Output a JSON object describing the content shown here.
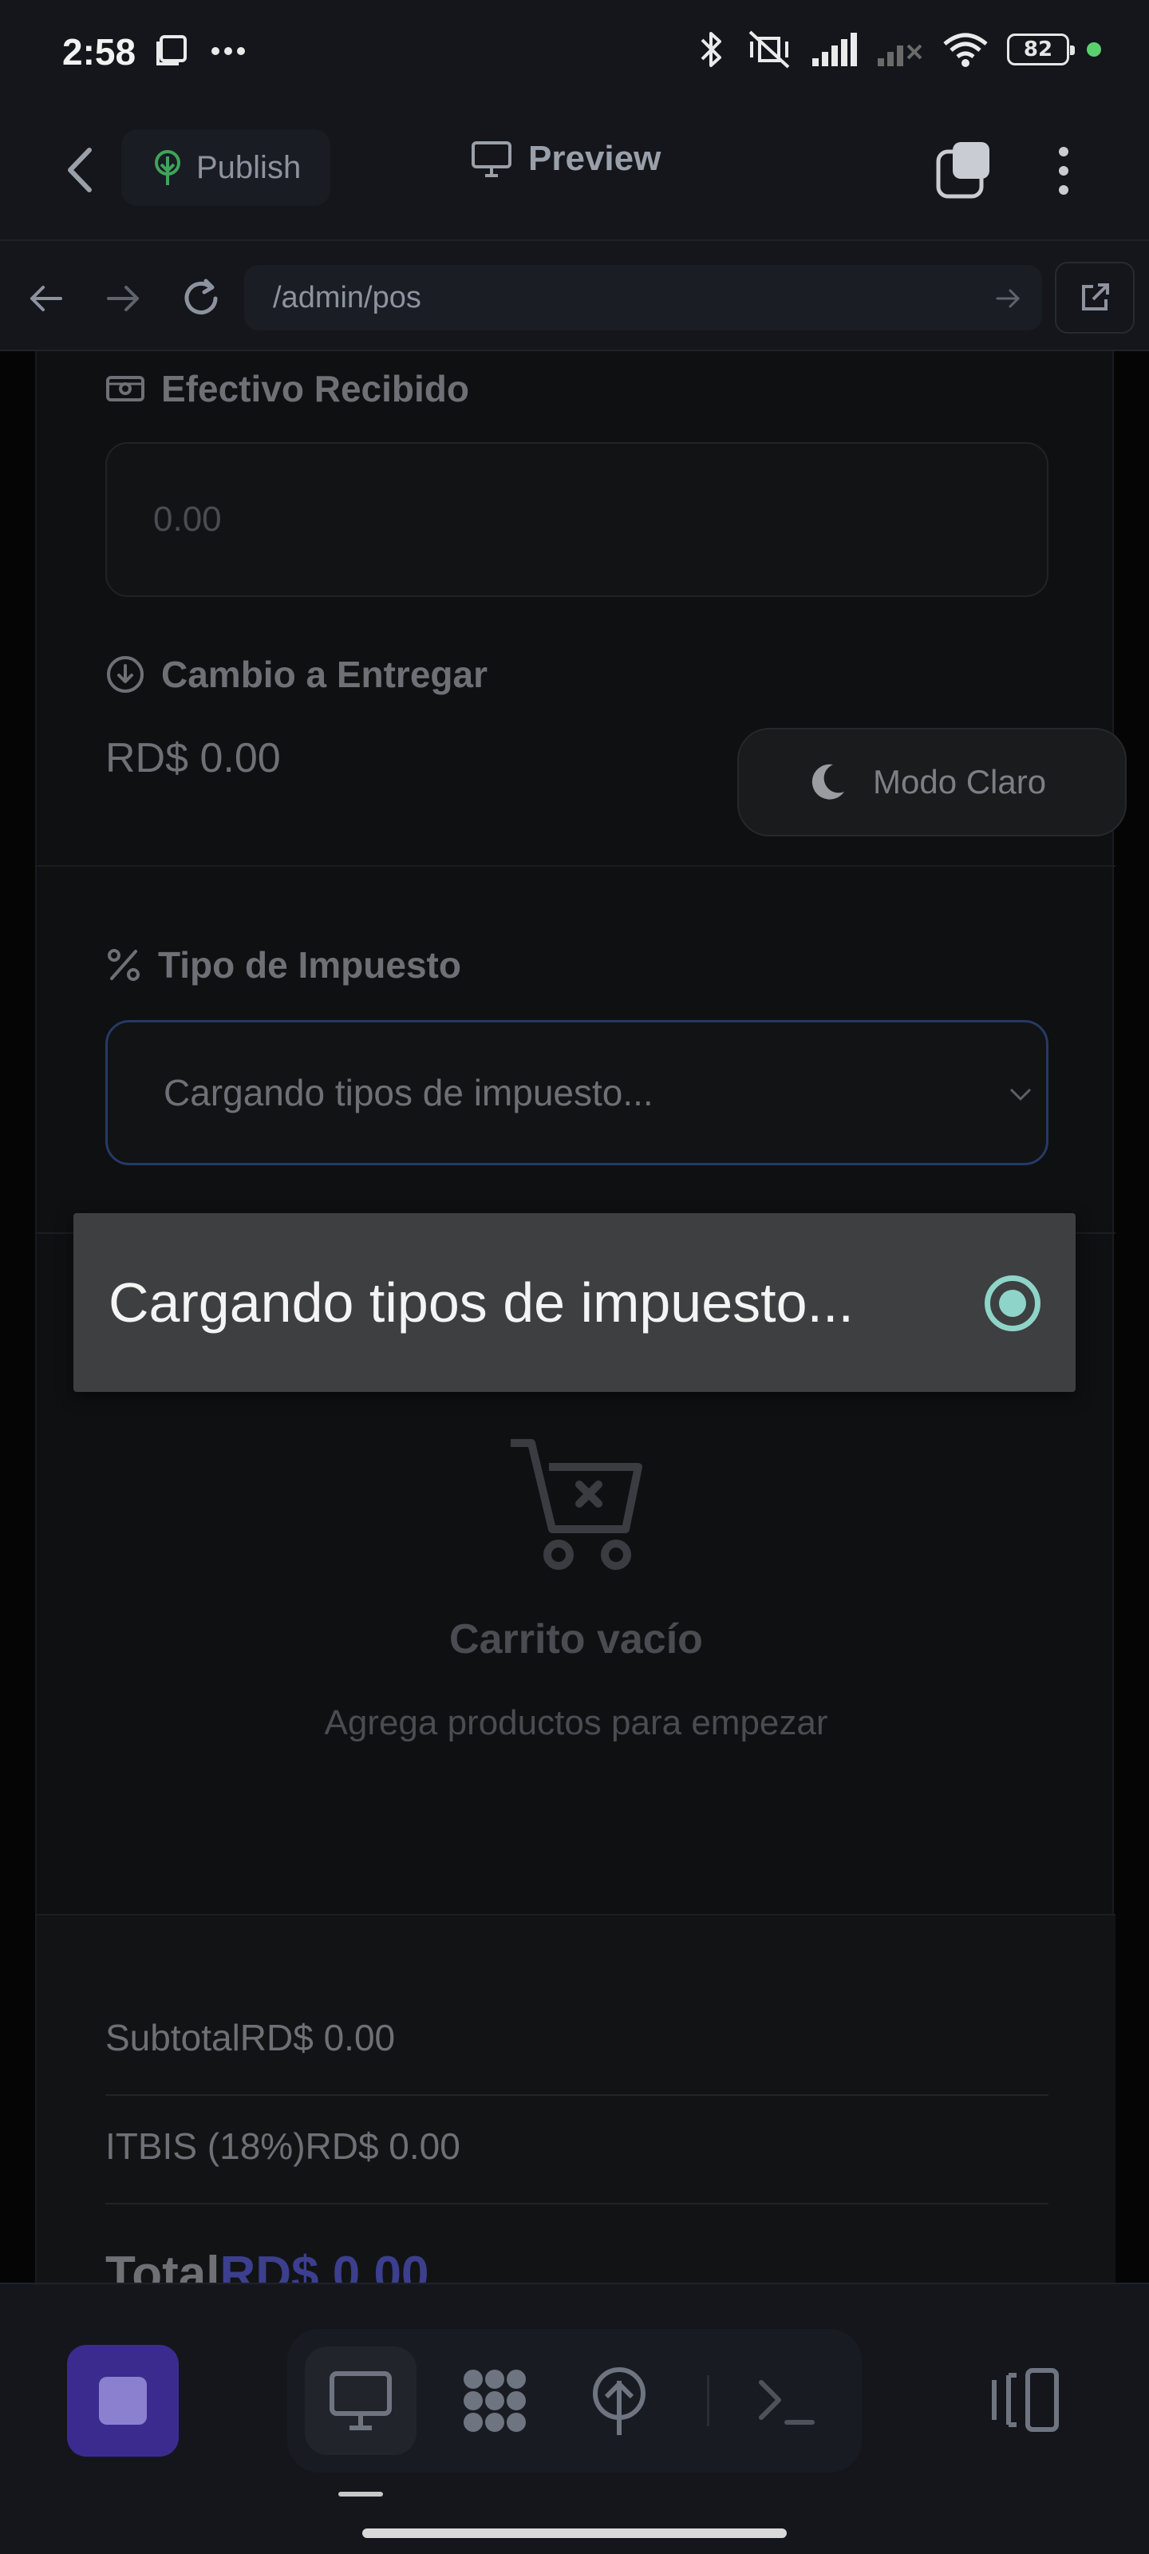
{
  "status_bar": {
    "time": "2:58",
    "left_icons": [
      "screen-icon",
      "more-dots-icon"
    ],
    "right_icons": [
      "bluetooth-icon",
      "mute-vibrate-icon",
      "signal-icon",
      "signal-off-icon",
      "wifi-icon"
    ],
    "battery": "82"
  },
  "app_bar": {
    "publish_label": "Publish",
    "preview_label": "Preview"
  },
  "url_bar": {
    "url": "/admin/pos"
  },
  "page": {
    "cash_received": {
      "label": "Efectivo Recibido",
      "placeholder": "0.00"
    },
    "change": {
      "label": "Cambio a Entregar",
      "value": "RD$ 0.00"
    },
    "tax": {
      "label": "Tipo de Impuesto",
      "selected": "Cargando tipos de impuesto..."
    },
    "theme_toggle": "Modo Claro",
    "cart": {
      "title": "Carrito vacío",
      "subtitle": "Agrega productos para empezar"
    },
    "summary": {
      "subtotal": "SubtotalRD$ 0.00",
      "tax_line": "ITBIS (18%)RD$ 0.00",
      "total_label": "Total",
      "total_value": "RD$ 0.00"
    }
  },
  "dropdown": {
    "options": [
      {
        "label": "Cargando tipos de impuesto...",
        "selected": true
      }
    ]
  },
  "colors": {
    "accent_stop": "#3b2b8f",
    "radio": "#8fd4c8",
    "select_border": "#253a66",
    "publish_icon": "#3fa35b"
  },
  "bottom_bar": {
    "tools": [
      "desktop-icon",
      "apps-grid-icon",
      "deploy-tree-icon",
      "terminal-icon"
    ],
    "panel_icon": "panel-toggle-icon"
  }
}
